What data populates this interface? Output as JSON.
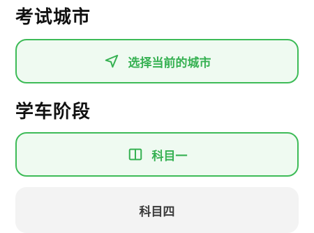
{
  "city_section": {
    "title": "考试城市",
    "select_button_label": "选择当前的城市",
    "icon": "navigation-arrow-icon"
  },
  "stage_section": {
    "title": "学车阶段",
    "options": [
      {
        "label": "科目一",
        "selected": true,
        "icon": "book-icon"
      },
      {
        "label": "科目四",
        "selected": false
      }
    ]
  },
  "colors": {
    "accent": "#3dbb57",
    "accent_text": "#36b152",
    "accent_bg": "#effaf1",
    "inactive_bg": "#f3f3f3",
    "title_text": "#111111"
  }
}
